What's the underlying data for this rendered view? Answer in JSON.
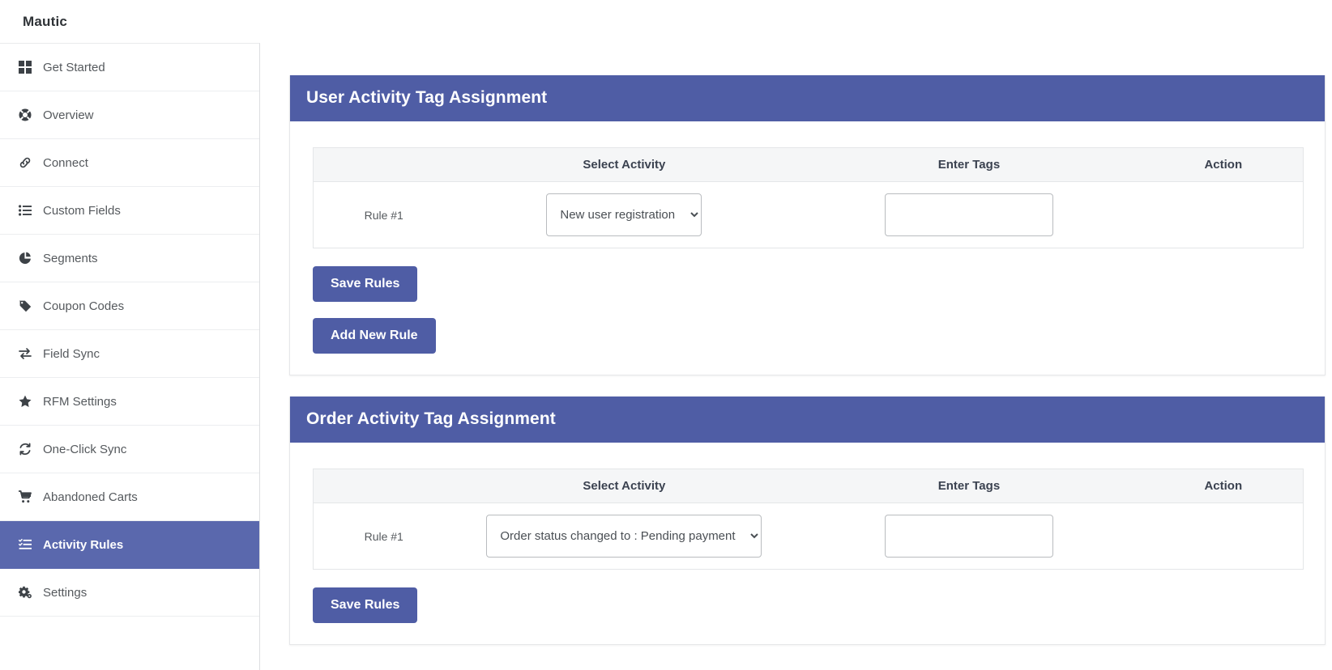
{
  "app": {
    "brand": "Mautic"
  },
  "sidebar": {
    "items": [
      {
        "label": "Get Started",
        "icon": "grid-icon",
        "active": false
      },
      {
        "label": "Overview",
        "icon": "lifebuoy-icon",
        "active": false
      },
      {
        "label": "Connect",
        "icon": "link-icon",
        "active": false
      },
      {
        "label": "Custom Fields",
        "icon": "list-icon",
        "active": false
      },
      {
        "label": "Segments",
        "icon": "pie-chart-icon",
        "active": false
      },
      {
        "label": "Coupon Codes",
        "icon": "tag-icon",
        "active": false
      },
      {
        "label": "Field Sync",
        "icon": "exchange-icon",
        "active": false
      },
      {
        "label": "RFM Settings",
        "icon": "star-icon",
        "active": false
      },
      {
        "label": "One-Click Sync",
        "icon": "refresh-icon",
        "active": false
      },
      {
        "label": "Abandoned Carts",
        "icon": "cart-icon",
        "active": false
      },
      {
        "label": "Activity Rules",
        "icon": "task-list-icon",
        "active": true
      },
      {
        "label": "Settings",
        "icon": "gears-icon",
        "active": false
      }
    ]
  },
  "panels": [
    {
      "title": "User Activity Tag Assignment",
      "columns": [
        "",
        "Select Activity",
        "Enter Tags",
        "Action"
      ],
      "rows": [
        {
          "rule_label": "Rule #1",
          "activity_value": "New user registration",
          "activity_options": [
            "New user registration"
          ],
          "tags_value": "",
          "tags_placeholder": "",
          "action": ""
        }
      ],
      "buttons": [
        "Save Rules",
        "Add New Rule"
      ]
    },
    {
      "title": "Order Activity Tag Assignment",
      "columns": [
        "",
        "Select Activity",
        "Enter Tags",
        "Action"
      ],
      "rows": [
        {
          "rule_label": "Rule #1",
          "activity_value": "Order status changed to : Pending payment",
          "activity_options": [
            "Order status changed to : Pending payment"
          ],
          "tags_value": "",
          "tags_placeholder": "",
          "action": ""
        }
      ],
      "buttons": [
        "Save Rules"
      ]
    }
  ],
  "colors": {
    "accent": "#4f5da5",
    "sidebar_active": "#5a68ad",
    "table_header_bg": "#f5f6f7",
    "border": "#e4e6e8"
  }
}
